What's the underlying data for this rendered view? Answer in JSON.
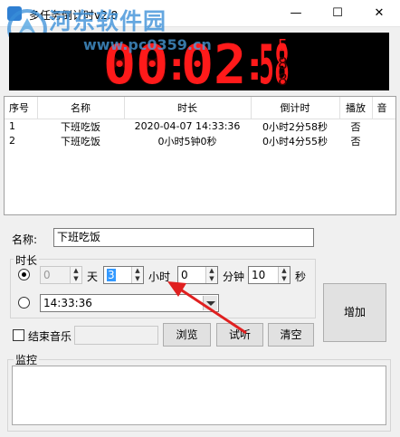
{
  "window": {
    "title": "多任务倒计时v2.8",
    "minimize_glyph": "—",
    "maximize_glyph": "☐",
    "close_glyph": "✕"
  },
  "watermark": {
    "site_name": "河东软件园",
    "url": "www.pc0359.cn"
  },
  "clock": {
    "hours": "00",
    "minutes": "02",
    "seconds": "58",
    "small_seconds": "5",
    "digit_color": "#ff1a1a",
    "dim_color": "#3a0000"
  },
  "table": {
    "headers": [
      "序号",
      "名称",
      "时长",
      "倒计时",
      "播放",
      "音"
    ],
    "rows": [
      [
        "1",
        "下班吃饭",
        "2020-04-07  14:33:36",
        "0小时2分58秒",
        "否",
        ""
      ],
      [
        "2",
        "下班吃饭",
        "0小时5钟0秒",
        "0小时4分55秒",
        "否",
        ""
      ]
    ]
  },
  "form": {
    "name_label": "名称:",
    "name_value": "下班吃饭",
    "duration_group_label": "时长",
    "days_value": "0",
    "days_unit": "天",
    "hours_value": "3",
    "hours_unit": "小时",
    "minutes_value": "0",
    "minutes_unit": "分钟",
    "seconds_value": "10",
    "seconds_unit": "秒",
    "datetime_value": "14:33:36",
    "add_button": "增加",
    "end_music_label": "结束音乐",
    "end_music_value": "",
    "browse_button": "浏览",
    "listen_button": "试听",
    "clear_button": "清空",
    "monitor_label": "监控",
    "monitor_value": ""
  },
  "colors": {
    "annotation_arrow": "#e02020",
    "watermark": "#3a8fd8"
  },
  "icons": {
    "app": "app-icon",
    "logo": "hedong-logo-icon",
    "arrow": "annotation-arrow-icon"
  }
}
